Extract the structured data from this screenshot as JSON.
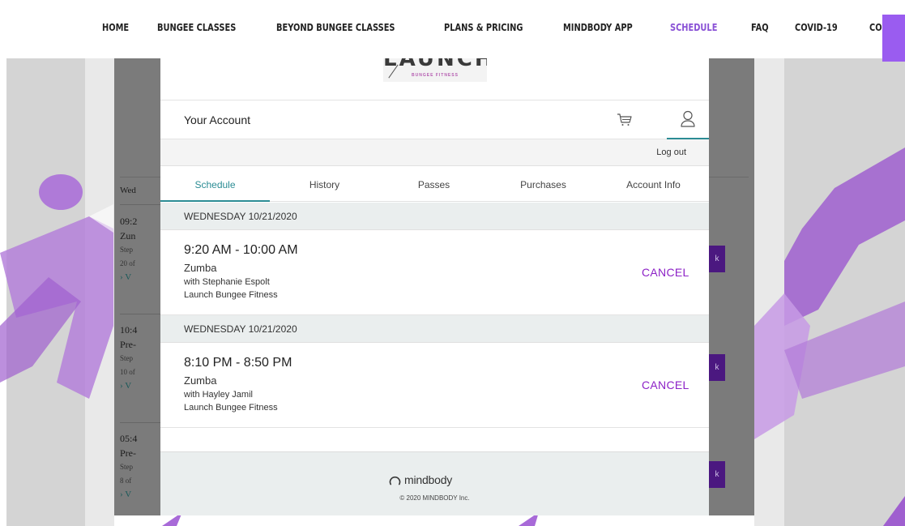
{
  "nav": {
    "items": [
      {
        "label": "HOME",
        "active": false
      },
      {
        "label": "BUNGEE CLASSES",
        "active": false
      },
      {
        "label": "BEYOND BUNGEE CLASSES",
        "active": false
      },
      {
        "label": "PLANS & PRICING",
        "active": false
      },
      {
        "label": "MINDBODY APP",
        "active": false
      },
      {
        "label": "SCHEDULE",
        "active": true
      },
      {
        "label": "FAQ",
        "active": false
      },
      {
        "label": "COVID-19",
        "active": false
      },
      {
        "label": "CONTACT",
        "active": false
      }
    ]
  },
  "background_page": {
    "header": "Wed",
    "rows": [
      {
        "time": "09:2",
        "name": "Zun",
        "sub": "Step",
        "spots": "20 of",
        "link": "› V"
      },
      {
        "time": "10:4",
        "name": "Pre-",
        "sub": "Step",
        "spots": "10 of",
        "link": "› V"
      },
      {
        "time": "05:4",
        "name": "Pre-",
        "sub": "Step",
        "spots": "8 of",
        "link": "› V"
      }
    ],
    "button_glyph": "k"
  },
  "logo": {
    "word": "LAUNCH",
    "tagline": "BUNGEE FITNESS"
  },
  "account": {
    "title": "Your Account",
    "logout": "Log out"
  },
  "icons": {
    "cart": "shopping-cart-icon",
    "user": "user-icon"
  },
  "tabs": [
    {
      "label": "Schedule",
      "active": true
    },
    {
      "label": "History",
      "active": false
    },
    {
      "label": "Passes",
      "active": false
    },
    {
      "label": "Purchases",
      "active": false
    },
    {
      "label": "Account Info",
      "active": false
    }
  ],
  "bookings": [
    {
      "date": "WEDNESDAY 10/21/2020",
      "time": "9:20 AM - 10:00 AM",
      "class": "Zumba",
      "teacher": "with Stephanie Espolt",
      "location": "Launch Bungee Fitness",
      "action": "CANCEL"
    },
    {
      "date": "WEDNESDAY 10/21/2020",
      "time": "8:10 PM - 8:50 PM",
      "class": "Zumba",
      "teacher": "with Hayley Jamil",
      "location": "Launch Bungee Fitness",
      "action": "CANCEL"
    }
  ],
  "footer": {
    "brand": "mindbody",
    "copyright": "© 2020 MINDBODY Inc."
  },
  "colors": {
    "accent_teal": "#2b8c94",
    "cancel_purple": "#8d22c7",
    "nav_active": "#8a52d6"
  }
}
